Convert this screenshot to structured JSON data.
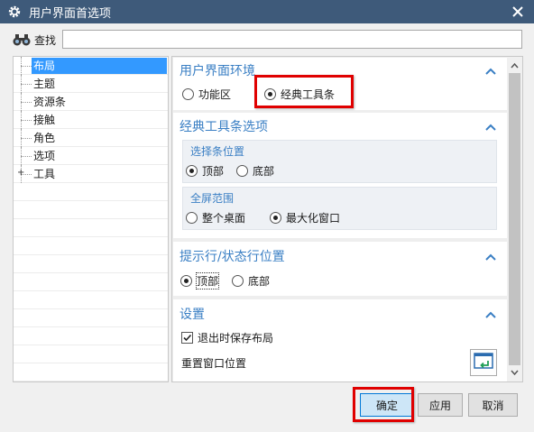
{
  "window": {
    "title": "用户界面首选项",
    "title_bar_color": "#3e5a7a"
  },
  "search": {
    "label": "查找",
    "value": "",
    "placeholder": ""
  },
  "tree": {
    "items": [
      {
        "label": "布局",
        "selected": true,
        "expandable": false
      },
      {
        "label": "主题",
        "selected": false,
        "expandable": false
      },
      {
        "label": "资源条",
        "selected": false,
        "expandable": false
      },
      {
        "label": "接触",
        "selected": false,
        "expandable": false
      },
      {
        "label": "角色",
        "selected": false,
        "expandable": false
      },
      {
        "label": "选项",
        "selected": false,
        "expandable": false
      },
      {
        "label": "工具",
        "selected": false,
        "expandable": true
      }
    ]
  },
  "sections": {
    "ui_env": {
      "title": "用户界面环境",
      "options": [
        "功能区",
        "经典工具条"
      ],
      "selected": "经典工具条"
    },
    "classic_toolbar": {
      "title": "经典工具条选项",
      "selection_bar": {
        "title": "选择条位置",
        "options": [
          "顶部",
          "底部"
        ],
        "selected": "顶部"
      },
      "fullscreen": {
        "title": "全屏范围",
        "options": [
          "整个桌面",
          "最大化窗口"
        ],
        "selected": "最大化窗口"
      }
    },
    "prompt_line": {
      "title": "提示行/状态行位置",
      "options": [
        "顶部",
        "底部"
      ],
      "selected": "顶部"
    },
    "settings": {
      "title": "设置",
      "save_layout_label": "退出时保存布局",
      "save_layout_checked": true,
      "reset_label": "重置窗口位置"
    }
  },
  "buttons": {
    "ok": "确定",
    "apply": "应用",
    "cancel": "取消"
  },
  "colors": {
    "accent": "#3a7fc4",
    "selection": "#3399ff",
    "highlight_box": "#e00000"
  }
}
